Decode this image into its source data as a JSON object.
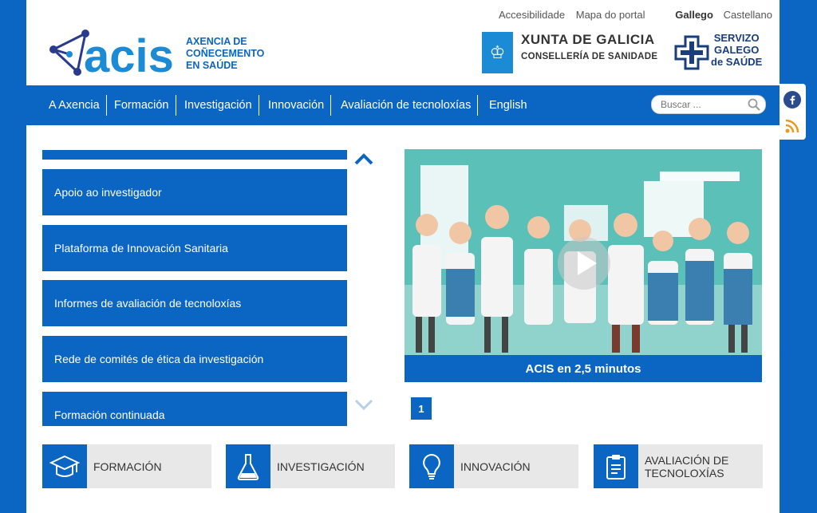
{
  "top_links": [
    "Accesibilidade",
    "Mapa do portal"
  ],
  "languages": {
    "active": "Gallego",
    "other": "Castellano"
  },
  "logo": {
    "wordmark": "acis",
    "line1": "AXENCIA DE",
    "line2": "COÑECEMENTO",
    "line3": "EN SAÚDE"
  },
  "xunta": {
    "title": "XUNTA DE GALICIA",
    "subtitle": "CONSELLERÍA DE SANIDADE"
  },
  "sergas": {
    "line1": "SERVIZO",
    "line2": "GALEGO",
    "line3": "de SAÚDE"
  },
  "nav": [
    "A Axencia",
    "Formación",
    "Investigación",
    "Innovación",
    "Avaliación de tecnoloxías",
    "English"
  ],
  "search": {
    "placeholder": "Buscar ..."
  },
  "slider_items": [
    "Apoio ao investigador",
    "Plataforma de Innovación Sanitaria",
    "Informes de avaliación de tecnoloxías",
    "Rede de comités de ética da investigación",
    "Formación continuada"
  ],
  "video": {
    "caption": "ACIS en 2,5 minutos"
  },
  "pager": {
    "current": "1"
  },
  "tiles": [
    {
      "label": "FORMACIÓN"
    },
    {
      "label": "INVESTIGACIÓN"
    },
    {
      "label": "INNOVACIÓN"
    },
    {
      "label": "AVALIACIÓN DE TECNOLOXÍAS"
    }
  ],
  "colors": {
    "primary": "#0a66c2",
    "tile_bg": "#e8e8e8",
    "video_bg": "#5ac0b8"
  },
  "icons": [
    "search-icon",
    "facebook-icon",
    "rss-icon",
    "chevron-up-icon",
    "chevron-down-icon",
    "play-icon",
    "graduation-cap-icon",
    "flask-icon",
    "lightbulb-icon",
    "clipboard-icon"
  ]
}
